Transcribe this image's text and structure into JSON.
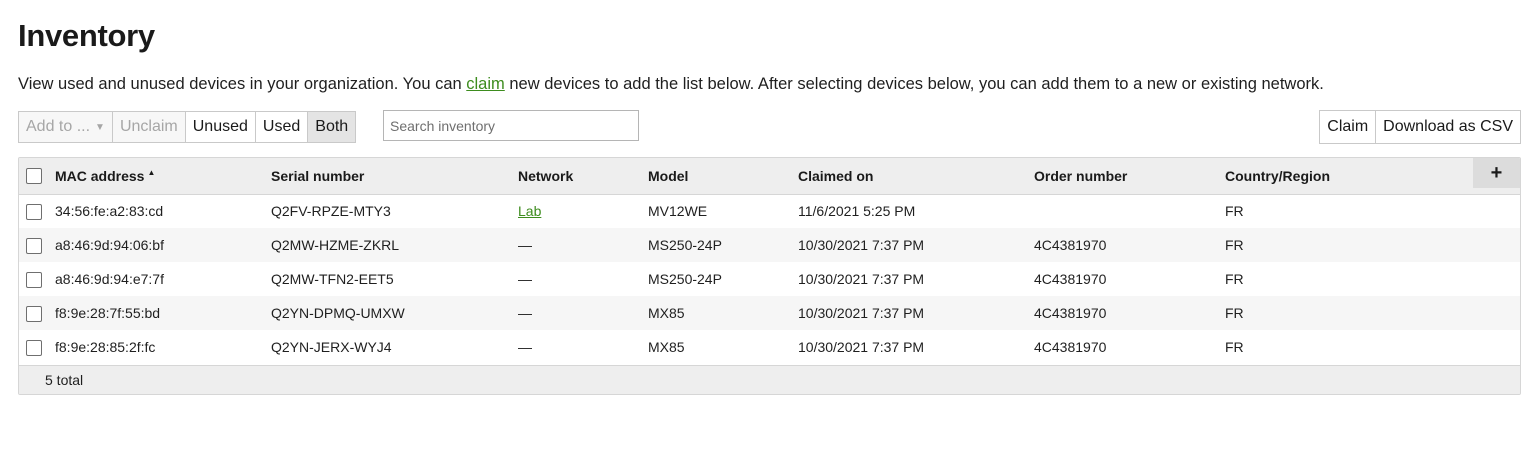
{
  "page": {
    "title": "Inventory",
    "description_before": "View used and unused devices in your organization. You can ",
    "description_link": "claim",
    "description_after": " new devices to add the list below. After selecting devices below, you can add them to a new or existing network."
  },
  "toolbar": {
    "add_to_label": "Add to ...",
    "unclaim_label": "Unclaim",
    "filter_unused": "Unused",
    "filter_used": "Used",
    "filter_both": "Both",
    "active_filter": "Both",
    "search_placeholder": "Search inventory",
    "claim_label": "Claim",
    "download_label": "Download as CSV"
  },
  "table": {
    "columns": {
      "mac": "MAC address",
      "serial": "Serial number",
      "network": "Network",
      "model": "Model",
      "claimed_on": "Claimed on",
      "order_number": "Order number",
      "country": "Country/Region"
    },
    "sort_column": "mac",
    "sort_direction": "ascending",
    "add_column_label": "+",
    "rows": [
      {
        "mac": "34:56:fe:a2:83:cd",
        "serial": "Q2FV-RPZE-MTY3",
        "network": "Lab",
        "network_is_link": true,
        "model": "MV12WE",
        "claimed_on": "11/6/2021 5:25 PM",
        "order_number": "",
        "country": "FR"
      },
      {
        "mac": "a8:46:9d:94:06:bf",
        "serial": "Q2MW-HZME-ZKRL",
        "network": "—",
        "network_is_link": false,
        "model": "MS250-24P",
        "claimed_on": "10/30/2021 7:37 PM",
        "order_number": "4C4381970",
        "country": "FR"
      },
      {
        "mac": "a8:46:9d:94:e7:7f",
        "serial": "Q2MW-TFN2-EET5",
        "network": "—",
        "network_is_link": false,
        "model": "MS250-24P",
        "claimed_on": "10/30/2021 7:37 PM",
        "order_number": "4C4381970",
        "country": "FR"
      },
      {
        "mac": "f8:9e:28:7f:55:bd",
        "serial": "Q2YN-DPMQ-UMXW",
        "network": "—",
        "network_is_link": false,
        "model": "MX85",
        "claimed_on": "10/30/2021 7:37 PM",
        "order_number": "4C4381970",
        "country": "FR"
      },
      {
        "mac": "f8:9e:28:85:2f:fc",
        "serial": "Q2YN-JERX-WYJ4",
        "network": "—",
        "network_is_link": false,
        "model": "MX85",
        "claimed_on": "10/30/2021 7:37 PM",
        "order_number": "4C4381970",
        "country": "FR"
      }
    ],
    "footer_total": "5 total"
  },
  "colors": {
    "link": "#3d8c1e",
    "header_bg": "#eeeeee",
    "active_filter_bg": "#e4e4e4"
  }
}
